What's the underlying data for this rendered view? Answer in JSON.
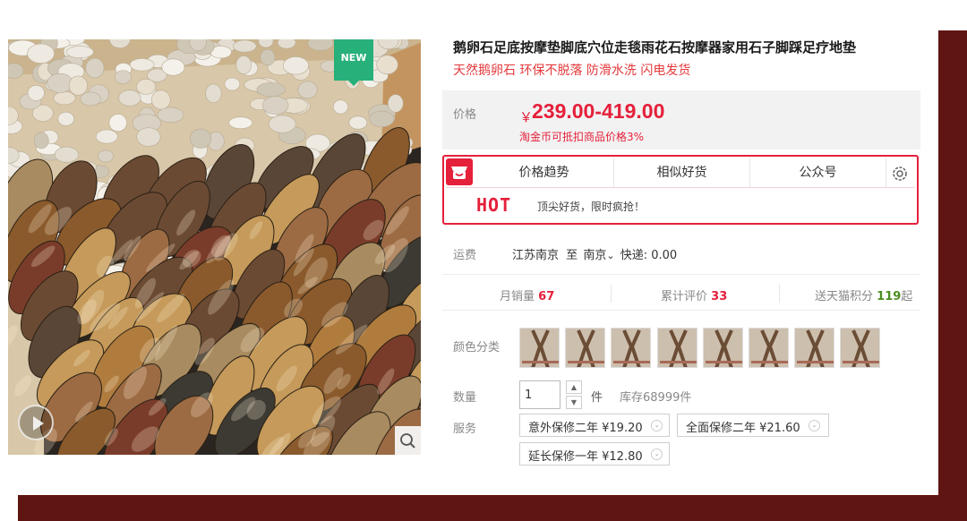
{
  "product": {
    "title": "鹅卵石足底按摩垫脚底穴位走毯雨花石按摩器家用石子脚踩足疗地垫",
    "subtitle": "天然鹅卵石 环保不脱落 防滑水洗 闪电发货",
    "badge": "NEW"
  },
  "price": {
    "label": "价格",
    "currency": "￥",
    "value": "239.00-419.00",
    "note": "淘金币可抵扣商品价格3%"
  },
  "toolbar": {
    "tabs": [
      "价格趋势",
      "相似好货",
      "公众号"
    ],
    "hot_label": "HOT",
    "hot_text": "顶尖好货，限时疯抢！"
  },
  "shipping": {
    "label": "运费",
    "from": "江苏南京",
    "to_label": "至",
    "to": "南京",
    "method": "快递: 0.00"
  },
  "stats": {
    "monthly_sales_label": "月销量",
    "monthly_sales": "67",
    "reviews_label": "累计评价",
    "reviews": "33",
    "points_label": "送天猫积分",
    "points": "119",
    "points_suffix": "起"
  },
  "color": {
    "label": "颜色分类",
    "swatch_count": 8
  },
  "quantity": {
    "label": "数量",
    "value": "1",
    "unit": "件",
    "stock": "库存68999件"
  },
  "service": {
    "label": "服务",
    "options": [
      "意外保修二年 ¥19.20",
      "全面保修二年 ¥21.60",
      "延长保修一年 ¥12.80"
    ]
  },
  "colors": {
    "accent": "#e5203b",
    "badge_green": "#27b07a",
    "frame": "#5f1511",
    "points_green": "#4b8d1e"
  },
  "icons": {
    "play": "play-icon",
    "zoom": "magnifier-icon",
    "logo": "shop-bag-icon",
    "settings": "gear-icon",
    "dropdown": "chevron-down-icon"
  }
}
